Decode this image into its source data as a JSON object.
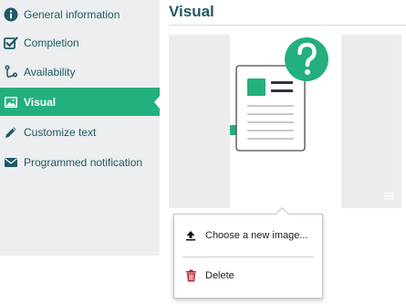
{
  "sidebar": {
    "items": [
      {
        "label": "General information",
        "icon": "info-icon"
      },
      {
        "label": "Completion",
        "icon": "checkbox-icon"
      },
      {
        "label": "Availability",
        "icon": "path-icon"
      },
      {
        "label": "Visual",
        "icon": "image-icon",
        "active": true
      },
      {
        "label": "Customize text",
        "icon": "pencil-icon"
      },
      {
        "label": "Programmed notification",
        "icon": "envelope-icon"
      }
    ]
  },
  "main": {
    "title": "Visual"
  },
  "popup": {
    "items": [
      {
        "label": "Choose a new image...",
        "icon": "upload-icon"
      },
      {
        "label": "Delete",
        "icon": "trash-icon"
      }
    ]
  },
  "colors": {
    "accent": "#22b07d",
    "text": "#1f5964",
    "delete": "#b5262b"
  }
}
